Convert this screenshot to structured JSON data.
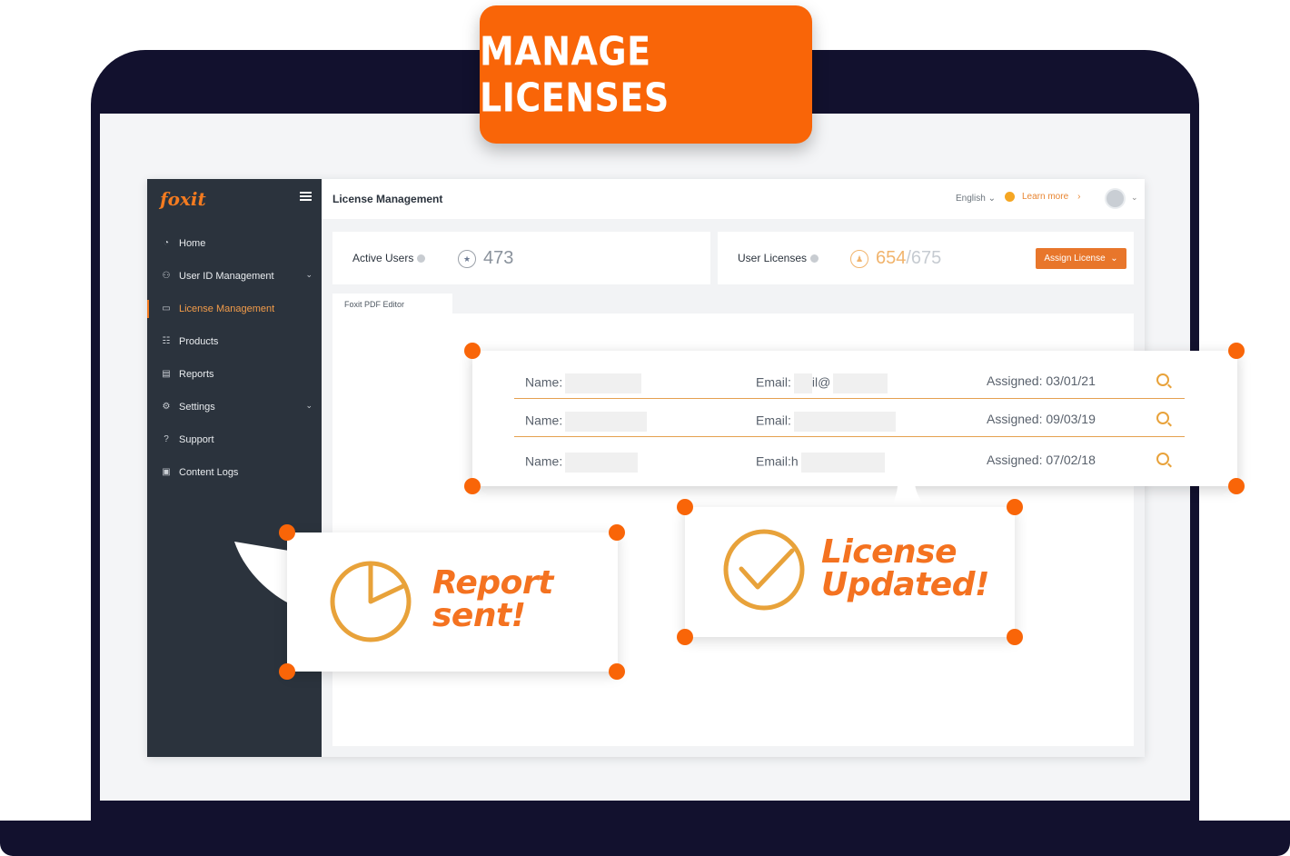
{
  "banner": {
    "title": "MANAGE LICENSES"
  },
  "app": {
    "logo": "foxit",
    "page_title": "License Management",
    "language": "English",
    "learn_more": "Learn more"
  },
  "sidebar": {
    "items": [
      {
        "label": "Home",
        "icon": "home-icon"
      },
      {
        "label": "User ID Management",
        "icon": "users-icon",
        "expandable": true
      },
      {
        "label": "License Management",
        "icon": "license-icon",
        "active": true
      },
      {
        "label": "Products",
        "icon": "products-icon"
      },
      {
        "label": "Reports",
        "icon": "reports-icon"
      },
      {
        "label": "Settings",
        "icon": "settings-icon",
        "expandable": true
      },
      {
        "label": "Support",
        "icon": "support-icon"
      },
      {
        "label": "Content Logs",
        "icon": "content-logs-icon"
      }
    ]
  },
  "stats": {
    "active_users_label": "Active Users",
    "active_users_value": "473",
    "user_licenses_label": "User Licenses",
    "licenses_used": "654",
    "licenses_total": "/675",
    "assign_button": "Assign License"
  },
  "product_tab": "Foxit PDF Editor",
  "license_rows": [
    {
      "name_label": "Name:",
      "email_label": "Email:",
      "email_visible": "il@",
      "assigned": "Assigned: 03/01/21"
    },
    {
      "name_label": "Name:",
      "email_label": "Email:",
      "email_visible": "",
      "assigned": "Assigned: 09/03/19"
    },
    {
      "name_label": "Name:",
      "email_label": "Email:",
      "email_visible": "h",
      "assigned": "Assigned: 07/02/18"
    }
  ],
  "callouts": {
    "report_line1": "Report",
    "report_line2": "sent!",
    "license_line1": "License",
    "license_line2": "Updated!"
  },
  "colors": {
    "accent": "#f96508",
    "sidebar": "#2b333d",
    "frame": "#12112e"
  }
}
